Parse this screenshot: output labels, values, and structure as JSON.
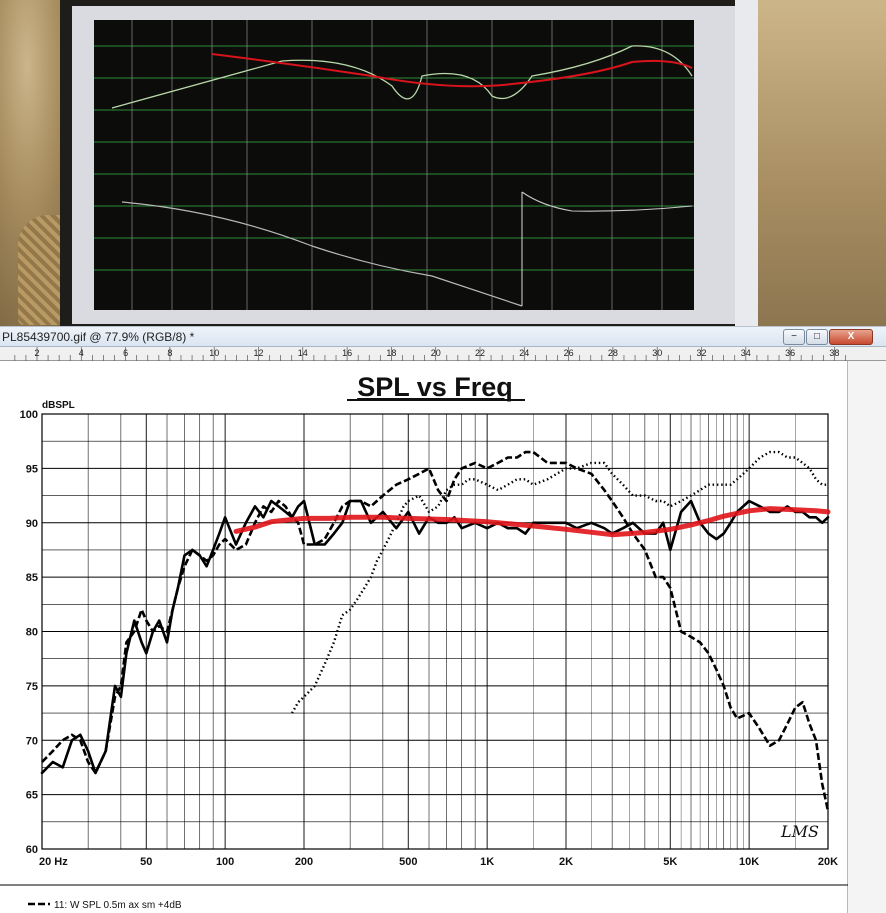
{
  "window": {
    "title": "PL85439700.gif @ 77.9% (RGB/8) *",
    "min_label": "−",
    "max_label": "□",
    "close_label": "X"
  },
  "ruler": {
    "ticks": [
      "2",
      "4",
      "6",
      "8",
      "10",
      "12",
      "14",
      "16",
      "18",
      "20",
      "22",
      "24",
      "26",
      "28",
      "30",
      "32",
      "34",
      "36",
      "38"
    ]
  },
  "legend": {
    "item1": "11: W SPL 0.5m ax sm +4dB"
  },
  "chart_data": {
    "type": "line",
    "title": "SPL vs Freq",
    "ylabel": "dBSPL",
    "xlabel": "",
    "xscale": "log",
    "xlim": [
      20,
      20000
    ],
    "ylim": [
      60,
      100
    ],
    "yticks": [
      "100",
      "95",
      "90",
      "85",
      "80",
      "75",
      "70",
      "65",
      "60"
    ],
    "xticks": [
      {
        "v": 20,
        "label": "20  Hz"
      },
      {
        "v": 50,
        "label": "50"
      },
      {
        "v": 100,
        "label": "100"
      },
      {
        "v": 200,
        "label": "200"
      },
      {
        "v": 500,
        "label": "500"
      },
      {
        "v": 1000,
        "label": "1K"
      },
      {
        "v": 2000,
        "label": "2K"
      },
      {
        "v": 5000,
        "label": "5K"
      },
      {
        "v": 10000,
        "label": "10K"
      },
      {
        "v": 20000,
        "label": "20K"
      }
    ],
    "watermark": "LMS",
    "series": [
      {
        "style": "solid",
        "color": "#000000",
        "x": [
          20,
          22,
          24,
          26,
          28,
          30,
          32,
          35,
          38,
          40,
          42,
          45,
          48,
          50,
          53,
          56,
          60,
          63,
          66,
          70,
          75,
          80,
          85,
          90,
          95,
          100,
          110,
          120,
          130,
          140,
          150,
          160,
          170,
          180,
          190,
          200,
          220,
          240,
          260,
          280,
          300,
          330,
          360,
          400,
          450,
          500,
          550,
          600,
          650,
          700,
          750,
          800,
          900,
          1000,
          1100,
          1200,
          1300,
          1400,
          1500,
          1700,
          2000,
          2200,
          2500,
          2800,
          3000,
          3300,
          3600,
          4000,
          4400,
          4700,
          5000,
          5500,
          6000,
          6500,
          7000,
          7500,
          8000,
          8500,
          9000,
          10000,
          11000,
          12000,
          13000,
          14000,
          15000,
          16000,
          17000,
          18000,
          19000,
          20000
        ],
        "y": [
          67,
          68,
          67.5,
          70,
          70.5,
          69,
          67,
          69,
          75,
          74,
          78,
          81,
          79,
          78,
          80,
          81,
          79,
          82,
          84,
          87,
          87.5,
          87,
          86,
          87.5,
          89,
          90.5,
          88,
          90,
          91.5,
          90.5,
          92,
          91.5,
          91,
          90.5,
          91.5,
          92,
          88,
          88,
          89,
          90,
          92,
          92,
          90,
          91,
          89.5,
          91,
          89,
          90.5,
          90,
          90,
          90.5,
          89.5,
          90,
          89.5,
          90,
          89.5,
          89.5,
          89,
          90,
          90,
          90,
          89.5,
          90,
          89.5,
          89,
          89.5,
          90,
          89,
          89,
          90,
          87.5,
          91,
          92,
          90,
          89,
          88.5,
          89,
          90,
          91,
          92,
          91.5,
          91,
          91,
          91.5,
          91,
          91,
          90.5,
          90.5,
          90,
          90.5
        ]
      },
      {
        "style": "dashed",
        "color": "#000000",
        "x": [
          20,
          22,
          24,
          26,
          28,
          30,
          32,
          35,
          38,
          40,
          42,
          45,
          48,
          50,
          53,
          56,
          60,
          63,
          66,
          70,
          75,
          80,
          85,
          90,
          95,
          100,
          110,
          120,
          130,
          140,
          150,
          160,
          170,
          180,
          190,
          200,
          220,
          240,
          260,
          280,
          300,
          330,
          360,
          400,
          450,
          500,
          550,
          600,
          650,
          700,
          750,
          800,
          900,
          1000,
          1100,
          1200,
          1300,
          1400,
          1500,
          1700,
          2000,
          2200,
          2500,
          2800,
          3000,
          3300,
          3600,
          4000,
          4400,
          4700,
          5000,
          5500,
          6000,
          6500,
          7000,
          7500,
          8000,
          8500,
          9000,
          10000,
          11000,
          12000,
          13000,
          14000,
          15000,
          16000,
          17000,
          18000,
          19000,
          20000
        ],
        "y": [
          68,
          69,
          70,
          70.5,
          70,
          68,
          67,
          69,
          74,
          75,
          79,
          80,
          82,
          81,
          80,
          80.5,
          80,
          82,
          84,
          86,
          87.5,
          87,
          86.5,
          87,
          88,
          88.5,
          87.5,
          88,
          90,
          91.5,
          91,
          92,
          91.5,
          90.5,
          90,
          88,
          88,
          88.5,
          90,
          91.5,
          92,
          92,
          91.5,
          92.5,
          93.5,
          94,
          94.5,
          95,
          93,
          92,
          94,
          95,
          95.5,
          95,
          95.5,
          96,
          96,
          96.5,
          96.5,
          95.5,
          95.5,
          95,
          94.5,
          93,
          92,
          90.5,
          89,
          87.5,
          85,
          85,
          84,
          80,
          79.5,
          79,
          78,
          76.5,
          75,
          73,
          72,
          72.5,
          71,
          69.5,
          70,
          71.5,
          73,
          73.5,
          71.5,
          70,
          66,
          63.5
        ]
      },
      {
        "style": "dotted",
        "color": "#000000",
        "x": [
          180,
          190,
          200,
          220,
          240,
          260,
          280,
          300,
          320,
          340,
          360,
          380,
          400,
          420,
          450,
          480,
          500,
          550,
          600,
          650,
          700,
          750,
          800,
          850,
          900,
          1000,
          1100,
          1200,
          1300,
          1400,
          1500,
          1700,
          2000,
          2200,
          2500,
          2800,
          3000,
          3300,
          3600,
          4000,
          4400,
          4700,
          5000,
          5500,
          6000,
          6500,
          7000,
          7500,
          8000,
          8500,
          9000,
          10000,
          11000,
          12000,
          13000,
          14000,
          15000,
          16000,
          17000,
          18000,
          19000,
          20000
        ],
        "y": [
          72.5,
          73.5,
          74,
          75,
          77,
          79,
          81.5,
          82,
          83,
          84,
          85,
          86.5,
          87.5,
          88.5,
          90,
          91.5,
          92,
          92.5,
          91,
          91.5,
          93,
          93.5,
          93.5,
          94,
          94,
          93.5,
          93,
          93.5,
          94,
          94,
          93.5,
          94,
          95,
          95,
          95.5,
          95.5,
          94.5,
          93.5,
          92.5,
          92.5,
          92,
          92,
          91.5,
          92,
          92.5,
          93,
          93.5,
          93.5,
          93.5,
          93.5,
          94,
          95,
          96,
          96.5,
          96.5,
          96,
          96,
          95.5,
          95,
          94,
          93.5,
          93.5
        ]
      },
      {
        "style": "smooth",
        "color": "#e0141a",
        "x": [
          110,
          130,
          150,
          180,
          200,
          250,
          300,
          400,
          500,
          700,
          1000,
          1500,
          2000,
          3000,
          4000,
          5000,
          6000,
          7000,
          8000,
          10000,
          12000,
          15000,
          18000,
          20000
        ],
        "y": [
          89.2,
          89.6,
          90.1,
          90.3,
          90.4,
          90.4,
          90.5,
          90.5,
          90.4,
          90.3,
          90.1,
          89.7,
          89.4,
          88.9,
          89.1,
          89.4,
          89.8,
          90.2,
          90.6,
          91.1,
          91.3,
          91.2,
          91.1,
          91.0
        ]
      }
    ]
  }
}
